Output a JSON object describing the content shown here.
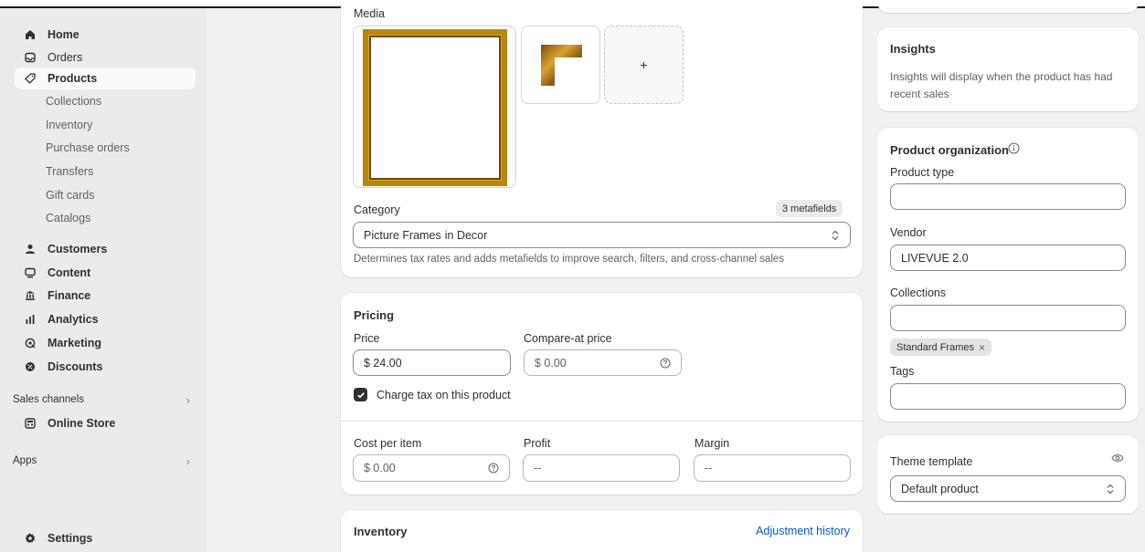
{
  "sidebar": {
    "items": [
      {
        "label": "Home",
        "icon": "home-icon"
      },
      {
        "label": "Orders",
        "icon": "inbox-icon"
      },
      {
        "label": "Products",
        "icon": "tag-icon"
      },
      {
        "label": "Customers",
        "icon": "person-icon"
      },
      {
        "label": "Content",
        "icon": "monitor-icon"
      },
      {
        "label": "Finance",
        "icon": "bank-icon"
      },
      {
        "label": "Analytics",
        "icon": "bar-chart-icon"
      },
      {
        "label": "Marketing",
        "icon": "target-icon"
      },
      {
        "label": "Discounts",
        "icon": "discount-icon"
      }
    ],
    "product_subitems": [
      "Collections",
      "Inventory",
      "Purchase orders",
      "Transfers",
      "Gift cards",
      "Catalogs"
    ],
    "sales_channels_label": "Sales channels",
    "online_store_label": "Online Store",
    "apps_label": "Apps",
    "settings_label": "Settings"
  },
  "media": {
    "label": "Media",
    "add_symbol": "+"
  },
  "category": {
    "label": "Category",
    "metafields_badge": "3 metafields",
    "value_bold": "Picture Frames",
    "value_rest": "in Decor",
    "help": "Determines tax rates and adds metafields to improve search, filters, and cross-channel sales"
  },
  "pricing": {
    "title": "Pricing",
    "price_label": "Price",
    "price_value": "$ 24.00",
    "compare_label": "Compare-at price",
    "compare_value": "$ 0.00",
    "charge_tax_label": "Charge tax on this product",
    "charge_tax_checked": true,
    "cost_label": "Cost per item",
    "cost_value": "$ 0.00",
    "profit_label": "Profit",
    "profit_value": "--",
    "margin_label": "Margin",
    "margin_value": "--"
  },
  "inventory": {
    "title": "Inventory",
    "adjustment_link": "Adjustment history"
  },
  "insights": {
    "title": "Insights",
    "body": "Insights will display when the product has had recent sales"
  },
  "organization": {
    "title": "Product organization",
    "type_label": "Product type",
    "type_value": "",
    "vendor_label": "Vendor",
    "vendor_value": "LIVEVUE 2.0",
    "collections_label": "Collections",
    "collections_value": "",
    "collection_tag": "Standard Frames",
    "tags_label": "Tags",
    "tags_value": ""
  },
  "theme": {
    "label": "Theme template",
    "value": "Default product"
  },
  "colors": {
    "link": "#005bd3",
    "frame_gold": "#b8860b",
    "active_nav_bg": "#fafafa"
  }
}
